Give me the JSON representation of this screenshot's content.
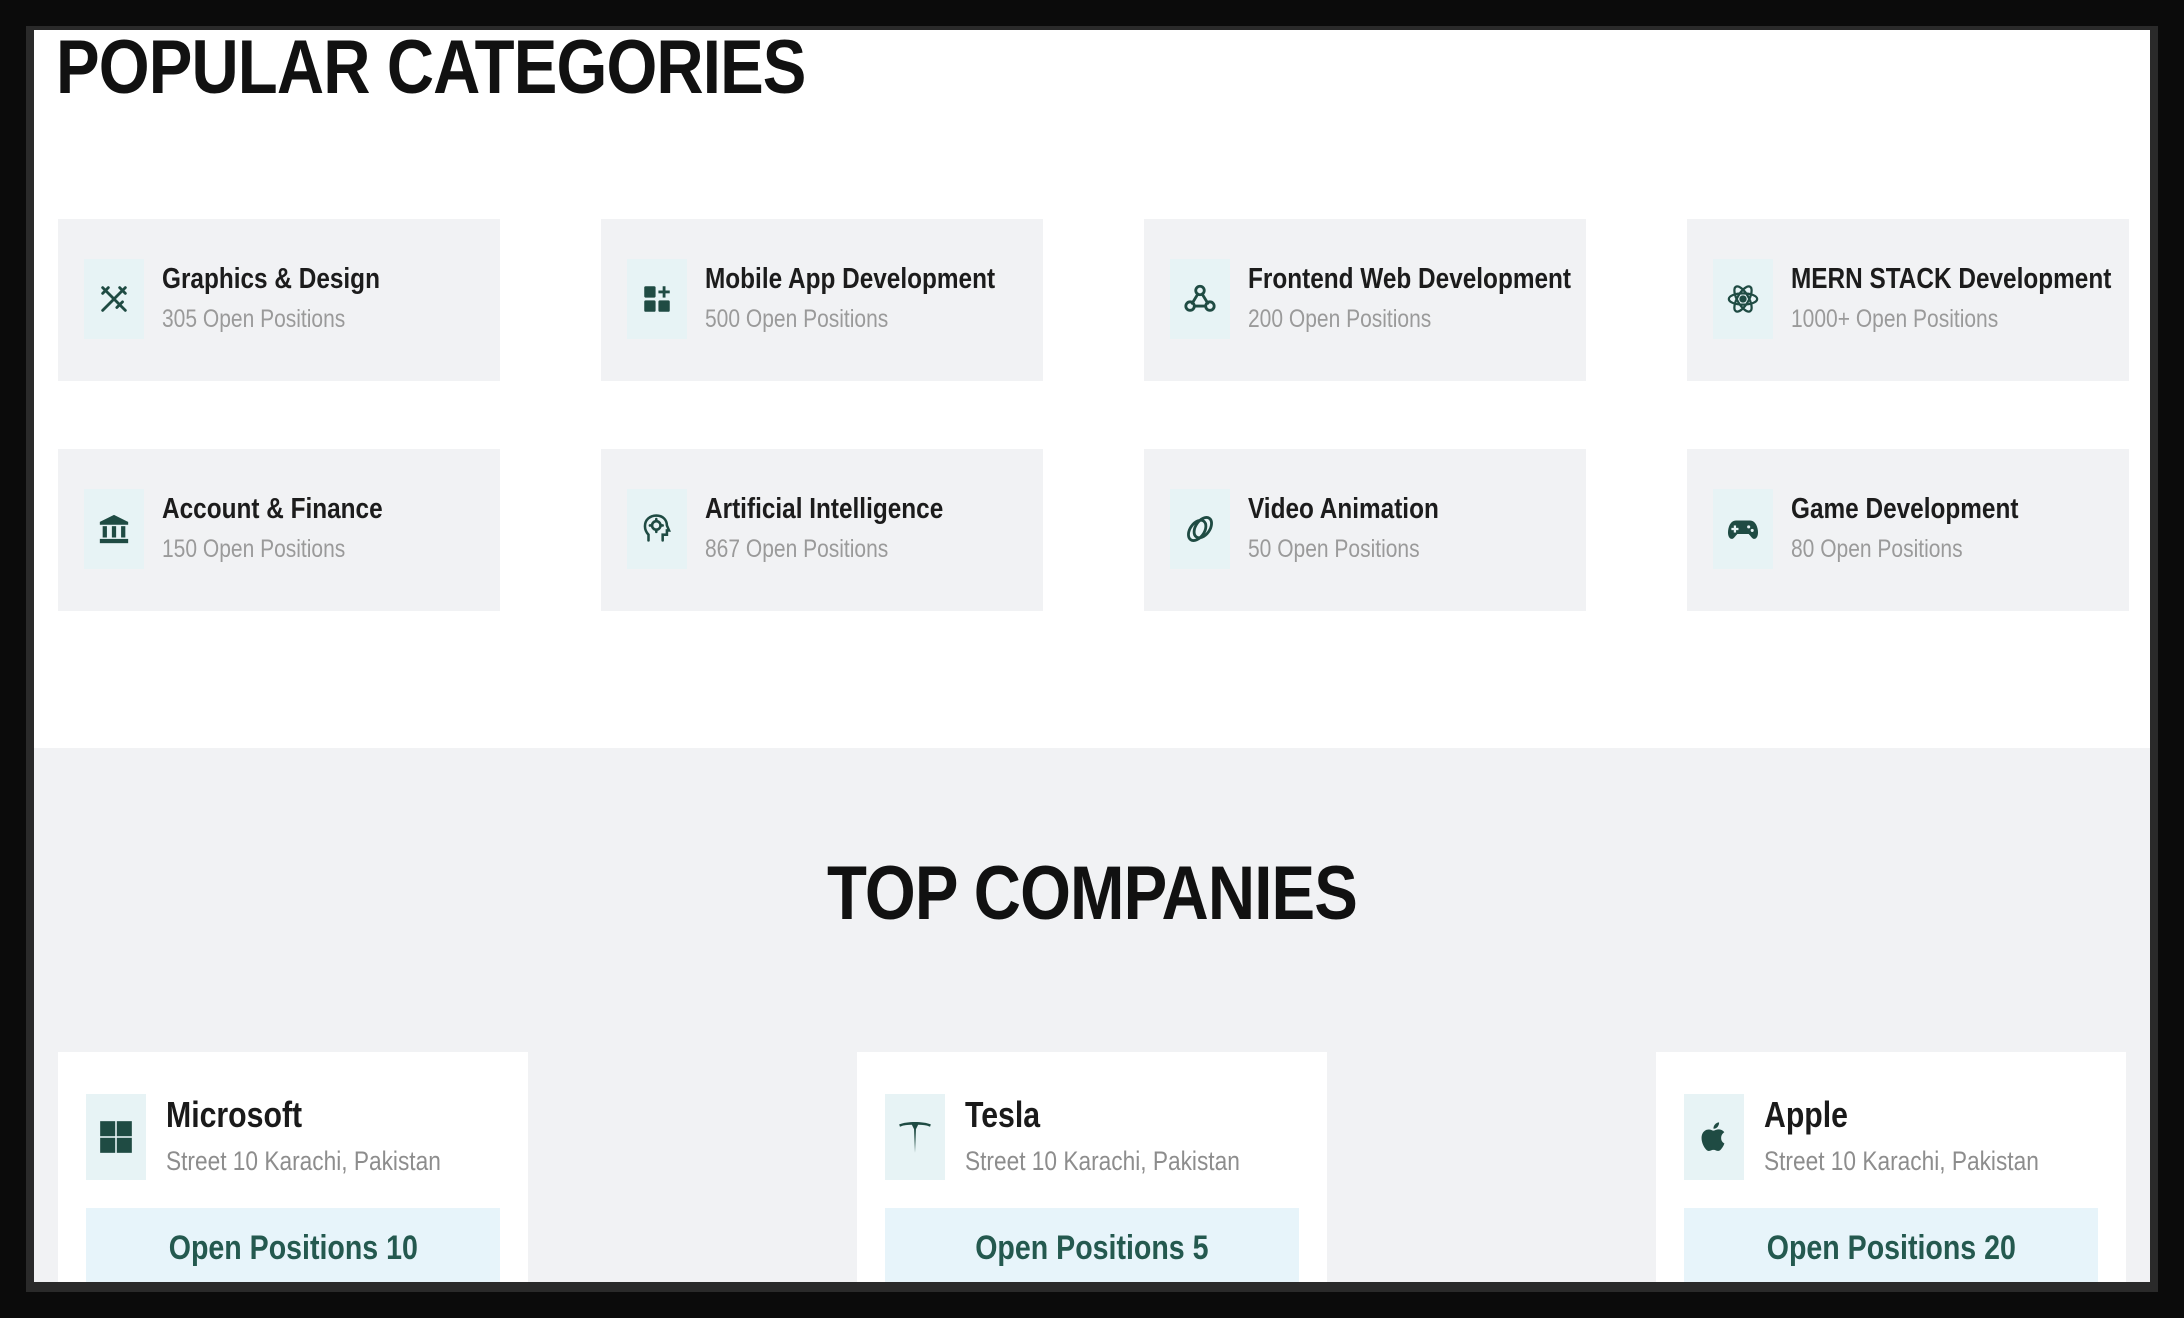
{
  "popular": {
    "title": "POPULAR CATEGORIES",
    "categories": [
      {
        "name": "Graphics & Design",
        "positions": "305 Open Positions",
        "icon": "pen-ruler-icon"
      },
      {
        "name": "Mobile App Development",
        "positions": "500 Open Positions",
        "icon": "app-grid-icon"
      },
      {
        "name": "Frontend Web Development",
        "positions": "200 Open Positions",
        "icon": "webhook-icon"
      },
      {
        "name": "MERN STACK Development",
        "positions": "1000+ Open Positions",
        "icon": "react-atom-icon"
      },
      {
        "name": "Account & Finance",
        "positions": "150 Open Positions",
        "icon": "bank-icon"
      },
      {
        "name": "Artificial Intelligence",
        "positions": "867 Open Positions",
        "icon": "ai-head-icon"
      },
      {
        "name": "Video Animation",
        "positions": "50 Open Positions",
        "icon": "rings-icon"
      },
      {
        "name": "Game Development",
        "positions": "80 Open Positions",
        "icon": "gamepad-icon"
      }
    ]
  },
  "companies": {
    "title": "TOP COMPANIES",
    "items": [
      {
        "name": "Microsoft",
        "address": "Street 10 Karachi, Pakistan",
        "button": "Open Positions 10",
        "icon": "microsoft-logo-icon"
      },
      {
        "name": "Tesla",
        "address": "Street 10 Karachi, Pakistan",
        "button": "Open Positions 5",
        "icon": "tesla-logo-icon"
      },
      {
        "name": "Apple",
        "address": "Street 10 Karachi, Pakistan",
        "button": "Open Positions 20",
        "icon": "apple-logo-icon"
      }
    ]
  },
  "colors": {
    "icon": "#1f4b43",
    "icon_bg": "#e7f3f5",
    "card_bg": "#f1f2f4",
    "button_bg": "#e7f4fa",
    "button_text": "#24594f"
  }
}
